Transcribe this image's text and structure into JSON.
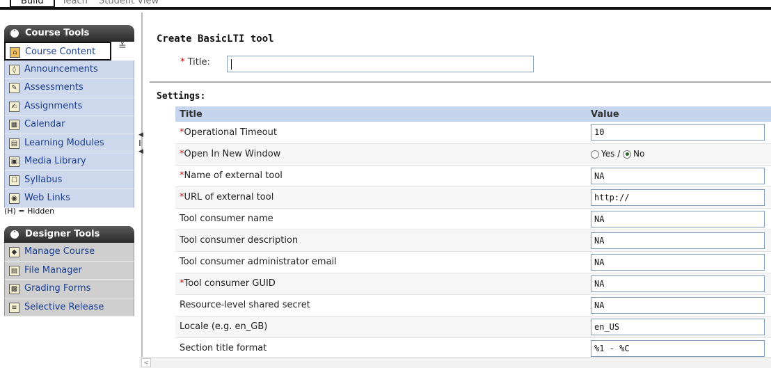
{
  "topbar": {
    "tab_build": "Build",
    "tab_teach": "Teach",
    "tab_student_view": "Student View"
  },
  "course_tools": {
    "header": "Course Tools",
    "items": [
      {
        "label": "Course Content",
        "icon": "house-icon"
      },
      {
        "label": "Announcements",
        "icon": "megaphone-icon"
      },
      {
        "label": "Assessments",
        "icon": "assessment-icon"
      },
      {
        "label": "Assignments",
        "icon": "assignment-icon"
      },
      {
        "label": "Calendar",
        "icon": "calendar-icon"
      },
      {
        "label": "Learning Modules",
        "icon": "learning-modules-icon"
      },
      {
        "label": "Media Library",
        "icon": "media-library-icon"
      },
      {
        "label": "Syllabus",
        "icon": "syllabus-icon"
      },
      {
        "label": "Web Links",
        "icon": "web-links-icon"
      }
    ],
    "hidden_note": "(H) = Hidden"
  },
  "designer_tools": {
    "header": "Designer Tools",
    "items": [
      {
        "label": "Manage Course",
        "icon": "manage-course-icon"
      },
      {
        "label": "File Manager",
        "icon": "file-manager-icon"
      },
      {
        "label": "Grading Forms",
        "icon": "grading-forms-icon"
      },
      {
        "label": "Selective Release",
        "icon": "selective-release-icon"
      }
    ]
  },
  "main": {
    "title": "Create BasicLTI tool",
    "title_label": "Title:",
    "title_value": "",
    "settings_label": "Settings:",
    "table_headers": {
      "title": "Title",
      "value": "Value"
    },
    "rows": [
      {
        "label": "Operational Timeout",
        "required": true,
        "type": "text",
        "value": "10"
      },
      {
        "label": "Open In New Window",
        "required": true,
        "type": "radio",
        "yes": "Yes",
        "no": "No",
        "selected": "No"
      },
      {
        "label": "Name of external tool",
        "required": true,
        "type": "text",
        "value": "NA"
      },
      {
        "label": "URL of external tool",
        "required": true,
        "type": "text",
        "value": "http://"
      },
      {
        "label": "Tool consumer name",
        "required": false,
        "type": "text",
        "value": "NA"
      },
      {
        "label": "Tool consumer description",
        "required": false,
        "type": "text",
        "value": "NA"
      },
      {
        "label": "Tool consumer administrator email",
        "required": false,
        "type": "text",
        "value": "NA"
      },
      {
        "label": "Tool consumer GUID",
        "required": true,
        "type": "text",
        "value": "NA"
      },
      {
        "label": "Resource-level shared secret",
        "required": false,
        "type": "text",
        "value": "NA"
      },
      {
        "label": "Locale (e.g. en_GB)",
        "required": false,
        "type": "text",
        "value": "en_US"
      },
      {
        "label": "Section title format",
        "required": false,
        "type": "text",
        "value": "%1 - %C"
      }
    ]
  },
  "colors": {
    "nav_blue": "#ced8ec",
    "nav_grey": "#cfcfcf",
    "header_bg": "#c5d5ee",
    "required": "#dd0000"
  }
}
